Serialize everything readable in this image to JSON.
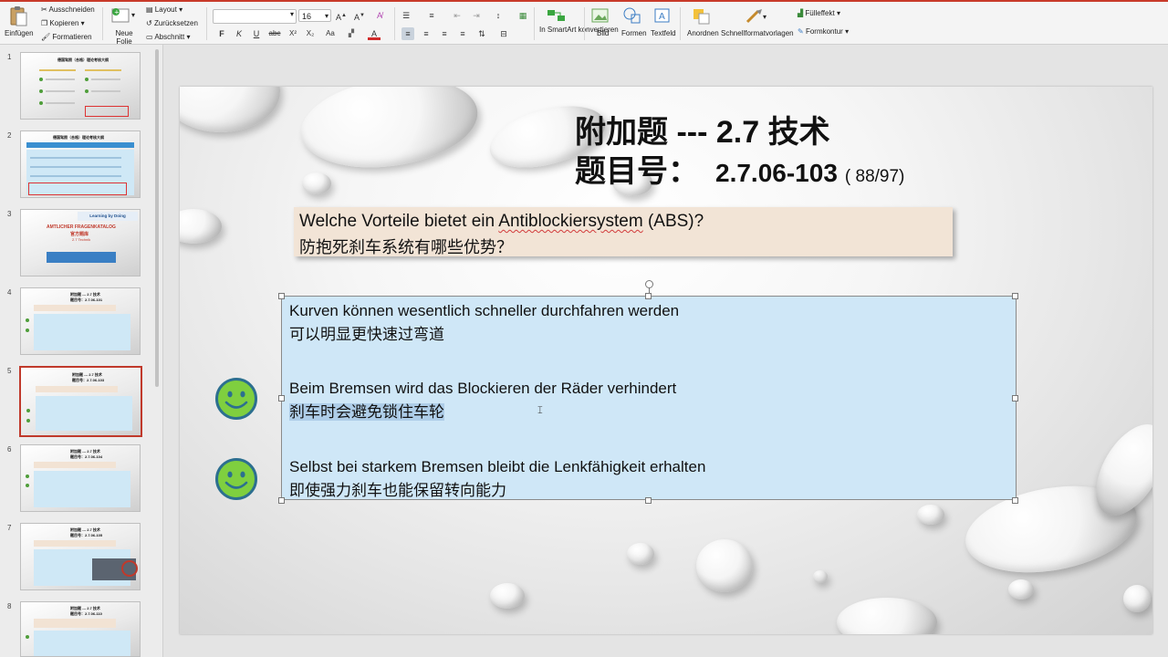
{
  "ribbon": {
    "paste_label": "Einfügen",
    "clipboard": {
      "cut": "Ausschneiden",
      "copy": "Kopieren",
      "format": "Formatieren"
    },
    "new_slide_label": "Neue Folie",
    "slides": {
      "layout": "Layout",
      "reset": "Zurücksetzen",
      "section": "Abschnitt"
    },
    "font_name": "",
    "font_size": "16",
    "font_buttons": {
      "bold": "F",
      "italic": "K",
      "underline": "U",
      "strike": "abc",
      "superscript": "X²",
      "subscript": "X₂",
      "aa": "Aa",
      "color": "A"
    },
    "smartart_label": "In SmartArt konvertieren",
    "picture_label": "Bild",
    "shapes_label": "Formen",
    "textbox_label": "Textfeld",
    "arrange_label": "Anordnen",
    "quickstyles_label": "Schnellformatvorlagen",
    "fill_label": "Fülleffekt",
    "outline_label": "Formkontur"
  },
  "thumbnails": [
    {
      "num": "1",
      "title": "德国驾照（合格）理论考核大纲",
      "selected": false
    },
    {
      "num": "2",
      "title": "德国驾照（合格）理论考核大纲",
      "selected": false
    },
    {
      "num": "3",
      "title": "AMTLICHER FRAGENKATALOG",
      "subtitle": "官方题库",
      "tag": "Learning by Doing",
      "section": "2.7 Technik",
      "selected": false
    },
    {
      "num": "4",
      "title": "附加题 --- 2.7 技术",
      "code": "题目号：2.7.06-101",
      "selected": false
    },
    {
      "num": "5",
      "title": "附加题 --- 2.7 技术",
      "code": "题目号：2.7.06-103",
      "selected": true
    },
    {
      "num": "6",
      "title": "附加题 --- 2.7 技术",
      "code": "题目号：2.7.06-104",
      "selected": false
    },
    {
      "num": "7",
      "title": "附加题 --- 2.7 技术",
      "code": "题目号：2.7.06-105",
      "selected": false
    },
    {
      "num": "8",
      "title": "附加题 --- 2.7 技术",
      "code": "题目号：2.7.06-110",
      "selected": false
    }
  ],
  "slide": {
    "title_line1": "附加题 --- 2.7 技术",
    "title_line2_prefix": "题目号：",
    "question_number": "2.7.06-103",
    "question_count": "( 88/97)",
    "question_de_prefix": "Welche Vorteile bietet ein ",
    "question_de_word": "Antiblockiersystem",
    "question_de_suffix": " (ABS)?",
    "question_cn": "防抱死刹车系统有哪些优势？",
    "answers": [
      {
        "de": "Kurven können wesentlich schneller durchfahren werden",
        "cn": "可以明显更快速过弯道",
        "correct": false
      },
      {
        "de": "Beim Bremsen wird das Blockieren der Räder verhindert",
        "cn": "刹车时会避免锁住车轮",
        "correct": true
      },
      {
        "de": "Selbst bei starkem Bremsen bleibt die Lenkfähigkeit erhalten",
        "cn": "即使强力刹车也能保留转向能力",
        "correct": true
      }
    ]
  },
  "colors": {
    "question_bg": "#f2e4d6",
    "answer_bg": "#cfe7f7",
    "smiley_green": "#7fcf3f",
    "smiley_ring": "#2c6f8f",
    "selected_thumb_border": "#c0392b"
  }
}
